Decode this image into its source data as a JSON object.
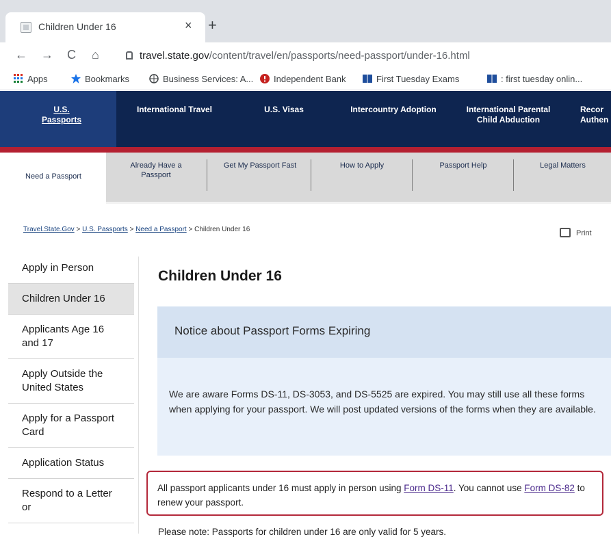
{
  "browser": {
    "tab_title": "Children Under 16",
    "tab_close": "×",
    "new_tab": "+",
    "url_domain": "travel.state.gov",
    "url_path": "/content/travel/en/passports/need-passport/under-16.html",
    "nav": {
      "back": "←",
      "forward": "→",
      "reload": "C",
      "home": "⌂"
    }
  },
  "bookmarks": [
    {
      "label": "Apps",
      "icon": "apps-grid-icon"
    },
    {
      "label": "Bookmarks",
      "icon": "star-icon"
    },
    {
      "label": "Business Services: A...",
      "icon": "globe-icon"
    },
    {
      "label": "Independent Bank",
      "icon": "bank-icon"
    },
    {
      "label": "First Tuesday Exams",
      "icon": "book-icon"
    },
    {
      "label": ": first tuesday onlin...",
      "icon": "book-icon"
    }
  ],
  "site_nav": [
    {
      "label": "U.S. Passports"
    },
    {
      "label": "International Travel"
    },
    {
      "label": "U.S. Visas"
    },
    {
      "label": "Intercountry Adoption"
    },
    {
      "label": "International Parental Child Abduction"
    },
    {
      "label": "Recor Authen"
    }
  ],
  "sub_nav": [
    {
      "label": "Need a Passport"
    },
    {
      "label": "Already Have a Passport"
    },
    {
      "label": "Get My Passport Fast"
    },
    {
      "label": "How to Apply"
    },
    {
      "label": "Passport Help"
    },
    {
      "label": "Legal Matters"
    }
  ],
  "breadcrumb": {
    "items": [
      "Travel.State.Gov",
      "U.S. Passports",
      "Need a Passport"
    ],
    "separator": ">",
    "current": "Children Under 16"
  },
  "print_label": "Print",
  "sidebar": [
    {
      "label": "Apply in Person"
    },
    {
      "label": "Children Under 16"
    },
    {
      "label": "Applicants Age 16 and 17"
    },
    {
      "label": "Apply Outside the United States"
    },
    {
      "label": "Apply for a Passport Card"
    },
    {
      "label": "Application Status"
    },
    {
      "label": "Respond to a Letter or"
    }
  ],
  "main": {
    "title": "Children Under 16",
    "notice_title": "Notice about Passport Forms Expiring",
    "notice_text": "We are aware Forms DS-11, DS-3053, and DS-5525 are expired. You may still use all these forms when applying for your passport. We will post updated versions of the forms when they are available.",
    "highlight": {
      "text_1": "All passport applicants under 16 must apply in person using ",
      "link_1": "Form DS-11",
      "text_2": ". You cannot use ",
      "link_2": "Form DS-82",
      "text_3": " to renew your passport."
    },
    "note": "Please note: Passports for children under 16 are only valid for 5 years."
  },
  "colors": {
    "nav_bg": "#0e2550",
    "red_bar": "#b42031",
    "highlight_border": "#b3283a",
    "link": "#4b2a8c"
  }
}
